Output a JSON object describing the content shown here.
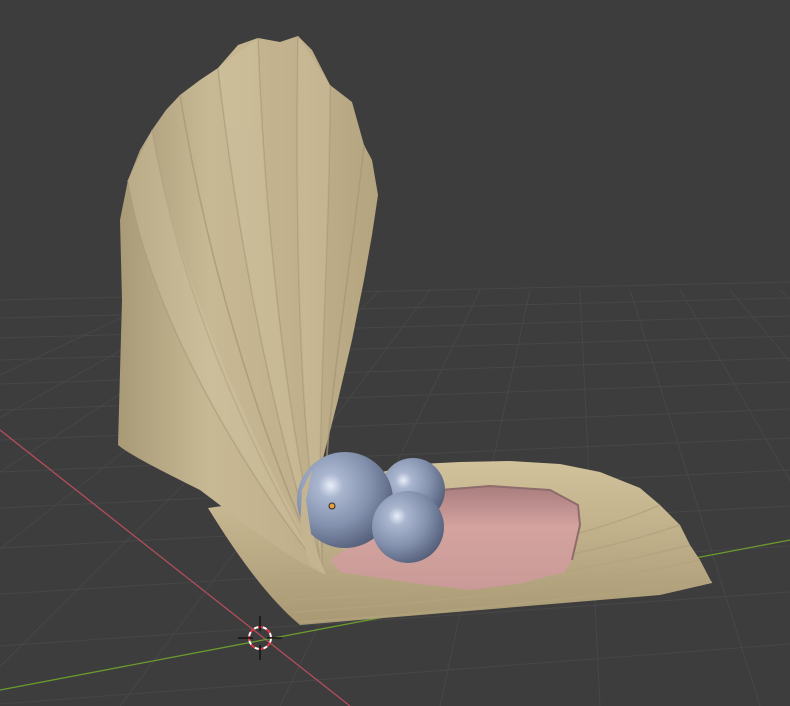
{
  "viewport": {
    "type": "3d-viewport",
    "background_color": "#3d3d3d",
    "grid_color": "#4a4a4a",
    "x_axis_color": "#b34d5c",
    "y_axis_color": "#6b9b2e"
  },
  "scene": {
    "objects": [
      {
        "name": "shell-top",
        "color": "#c9b994"
      },
      {
        "name": "shell-bottom",
        "color": "#cdbd98"
      },
      {
        "name": "shell-inner",
        "color": "#d4a3a0"
      },
      {
        "name": "pearl-large",
        "color": "#8f9cb8"
      },
      {
        "name": "pearl-small-back",
        "color": "#96a3bf"
      },
      {
        "name": "pearl-small-front",
        "color": "#93a0bd"
      }
    ],
    "origin_point_color": "#e8a13a",
    "cursor_icon": "3d-cursor-icon"
  }
}
